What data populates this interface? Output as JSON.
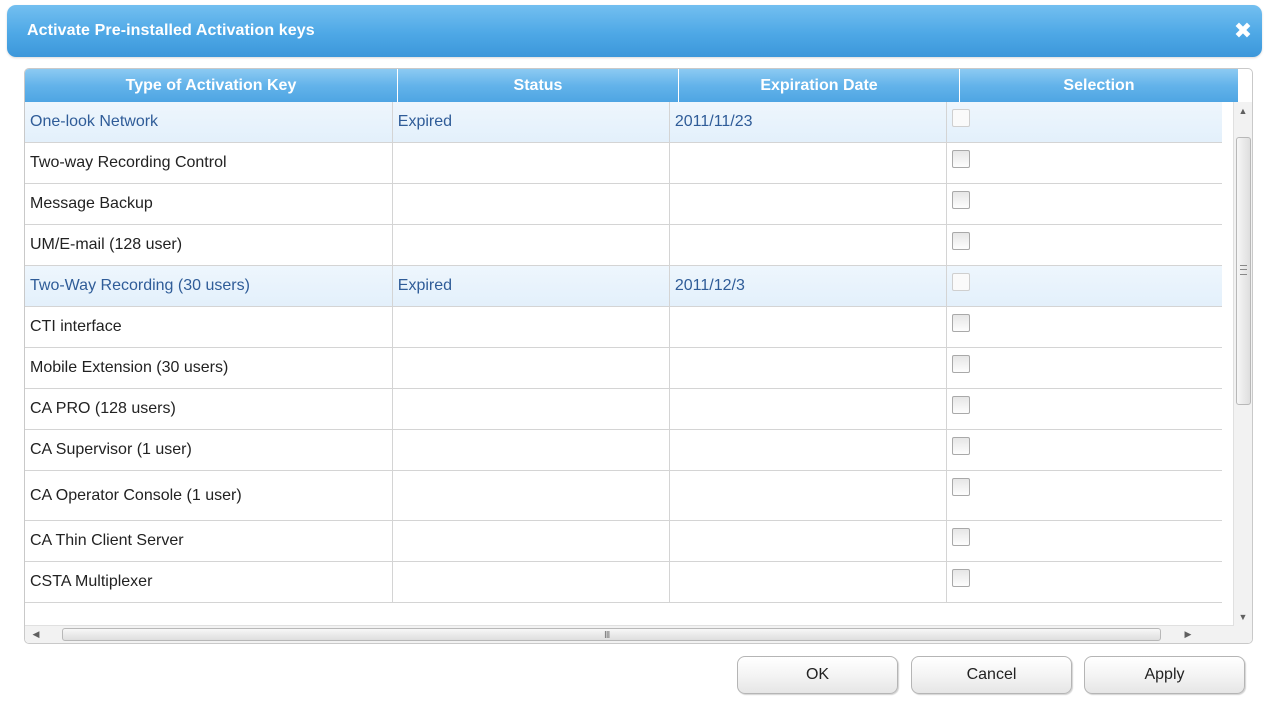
{
  "dialog": {
    "title": "Activate Pre-installed Activation keys",
    "close_glyph": "✖"
  },
  "table": {
    "columns": [
      "Type of Activation Key",
      "Status",
      "Expiration Date",
      "Selection"
    ],
    "rows": [
      {
        "type": "One-look Network",
        "status": "Expired",
        "expiration": "2011/11/23",
        "selectable": false,
        "highlighted": true
      },
      {
        "type": "Two-way Recording Control",
        "status": "",
        "expiration": "",
        "selectable": true,
        "highlighted": false
      },
      {
        "type": "Message Backup",
        "status": "",
        "expiration": "",
        "selectable": true,
        "highlighted": false
      },
      {
        "type": "UM/E-mail (128 user)",
        "status": "",
        "expiration": "",
        "selectable": true,
        "highlighted": false
      },
      {
        "type": "Two-Way Recording (30 users)",
        "status": "Expired",
        "expiration": "2011/12/3",
        "selectable": false,
        "highlighted": true
      },
      {
        "type": "CTI interface",
        "status": "",
        "expiration": "",
        "selectable": true,
        "highlighted": false
      },
      {
        "type": "Mobile Extension (30 users)",
        "status": "",
        "expiration": "",
        "selectable": true,
        "highlighted": false
      },
      {
        "type": "CA PRO (128 users)",
        "status": "",
        "expiration": "",
        "selectable": true,
        "highlighted": false
      },
      {
        "type": "CA Supervisor (1 user)",
        "status": "",
        "expiration": "",
        "selectable": true,
        "highlighted": false
      },
      {
        "type": "CA Operator Console (1 user)",
        "status": "",
        "expiration": "",
        "selectable": true,
        "highlighted": false
      },
      {
        "type": "CA Thin Client Server",
        "status": "",
        "expiration": "",
        "selectable": true,
        "highlighted": false
      },
      {
        "type": "CSTA Multiplexer",
        "status": "",
        "expiration": "",
        "selectable": true,
        "highlighted": false
      }
    ]
  },
  "scrollbars": {
    "up_arrow": "▲",
    "down_arrow": "▼",
    "left_arrow": "◀",
    "right_arrow": "▶",
    "h_grip": "III"
  },
  "buttons": {
    "ok": "OK",
    "cancel": "Cancel",
    "apply": "Apply"
  },
  "colors": {
    "title_bar": "#4ea8e6",
    "header": "#63b3ea",
    "highlight_text": "#2f5c98"
  }
}
